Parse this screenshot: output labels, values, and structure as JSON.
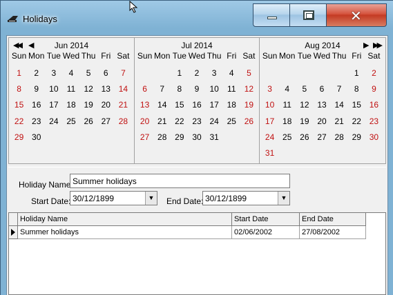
{
  "window": {
    "title": "Holidays",
    "icon": "holidays-app-icon"
  },
  "titlebar_buttons": {
    "minimize": "minimize-icon",
    "maximize": "maximize-icon",
    "close": "close-icon"
  },
  "calendar": {
    "dow": [
      "Sun",
      "Mon",
      "Tue",
      "Wed",
      "Thu",
      "Fri",
      "Sat"
    ],
    "months": [
      {
        "title": "Jun 2014",
        "first_weekday": 0,
        "days": 30
      },
      {
        "title": "Jul 2014",
        "first_weekday": 2,
        "days": 31
      },
      {
        "title": "Aug 2014",
        "first_weekday": 5,
        "days": 31
      }
    ],
    "weekend_color": "#c01010",
    "nav": {
      "prev_year": "double-left-arrow-icon",
      "prev_month": "left-arrow-icon",
      "next_month": "right-arrow-icon",
      "next_year": "double-right-arrow-icon"
    }
  },
  "form": {
    "holiday_name_label": "Holiday Name:",
    "holiday_name_value": "Summer holidays",
    "start_date_label": "Start Date:",
    "start_date_value": "30/12/1899",
    "end_date_label": "End Date:",
    "end_date_value": "30/12/1899"
  },
  "table": {
    "columns": [
      "Holiday Name",
      "Start Date",
      "End Date"
    ],
    "rows": [
      [
        "Summer holidays",
        "02/06/2002",
        "27/08/2002"
      ]
    ]
  }
}
